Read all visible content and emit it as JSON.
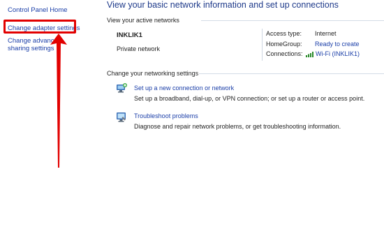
{
  "left_nav": {
    "home_label": "Control Panel Home",
    "adapter_label": "Change adapter settings",
    "sharing_label": "Change advanced sharing settings"
  },
  "main": {
    "title": "View your basic network information and set up connections",
    "active_networks": {
      "section_label": "View your active networks",
      "network_name": "INKLIK1",
      "network_type": "Private network",
      "access_type_key": "Access type:",
      "access_type_value": "Internet",
      "homegroup_key": "HomeGroup:",
      "homegroup_value": "Ready to create",
      "connections_key": "Connections:",
      "connections_value": "Wi-Fi (INKLIK1)"
    },
    "change_settings": {
      "section_label": "Change your networking settings",
      "tasks": [
        {
          "link": "Set up a new connection or network",
          "description": "Set up a broadband, dial-up, or VPN connection; or set up a router or access point.",
          "icon": "network-setup-icon"
        },
        {
          "link": "Troubleshoot problems",
          "description": "Diagnose and repair network problems, or get troubleshooting information.",
          "icon": "troubleshoot-icon"
        }
      ]
    }
  },
  "colors": {
    "link": "#1a3ea8",
    "title": "#1e3a8a",
    "highlight": "#e20000"
  }
}
